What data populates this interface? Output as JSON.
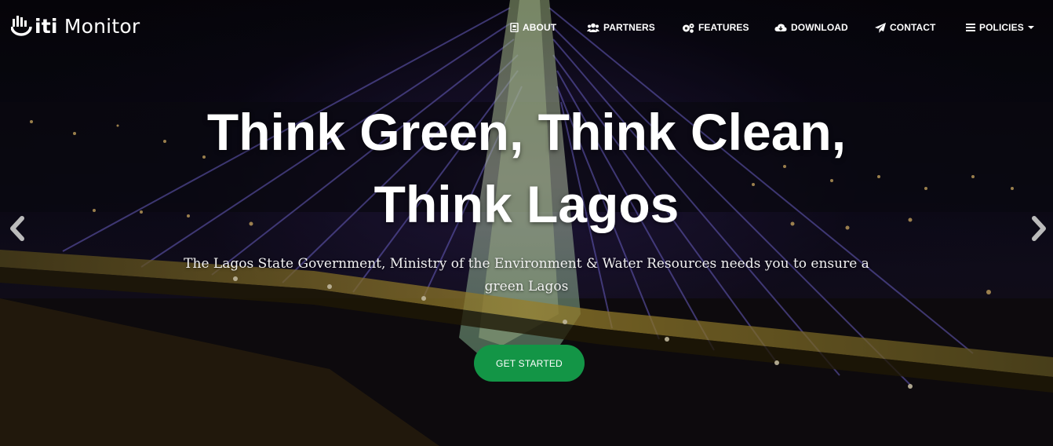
{
  "brand": {
    "logo_prefix": "iti",
    "logo_suffix": "Monitor"
  },
  "nav": {
    "items": [
      {
        "label": "ABOUT",
        "icon": "id-card-icon"
      },
      {
        "label": "PARTNERS",
        "icon": "users-icon"
      },
      {
        "label": "FEATURES",
        "icon": "gears-icon"
      },
      {
        "label": "DOWNLOAD",
        "icon": "cloud-download-icon"
      },
      {
        "label": "CONTACT",
        "icon": "paper-plane-icon"
      },
      {
        "label": "POLICIES",
        "icon": "menu-bars-icon",
        "dropdown": true
      }
    ]
  },
  "hero": {
    "headline_line1": "Think Green, Think Clean,",
    "headline_line2": "Think Lagos",
    "subtext_line1": "The Lagos State Government, Ministry of the Environment & Water Resources needs you to ensure a",
    "subtext_line2": "green Lagos",
    "cta_label": "GET STARTED"
  },
  "carousel": {
    "prev_icon": "chevron-left-icon",
    "next_icon": "chevron-right-icon"
  },
  "colors": {
    "cta": "#139546",
    "text": "#ffffff"
  }
}
